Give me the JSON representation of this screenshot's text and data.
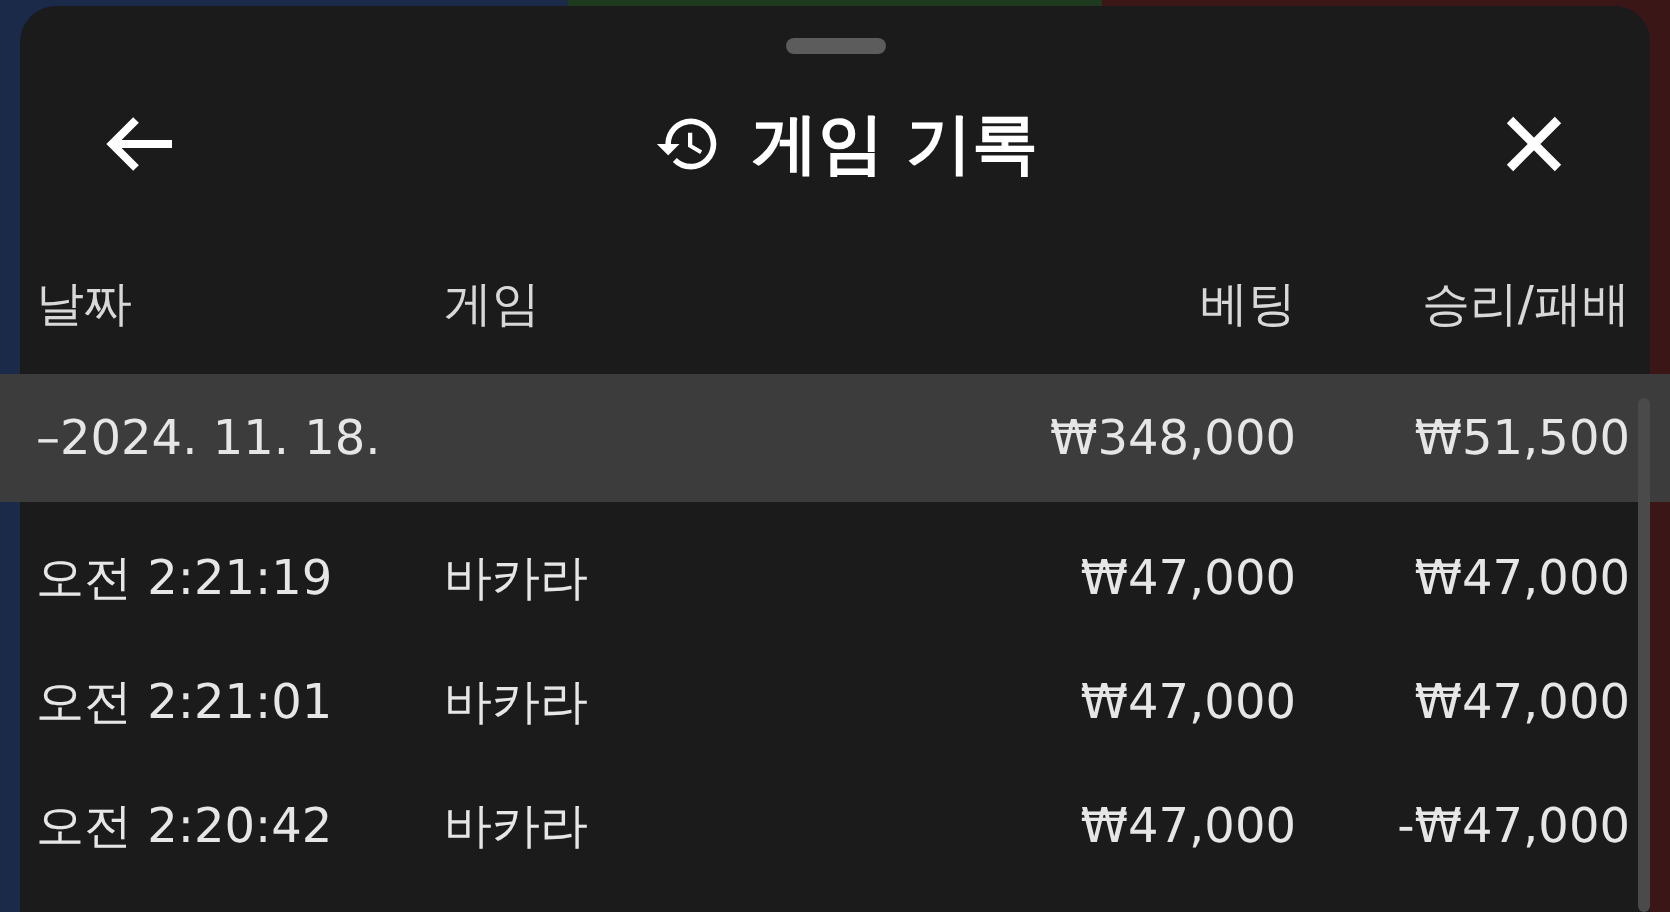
{
  "header": {
    "title": "게임 기록"
  },
  "table": {
    "columns": [
      "날짜",
      "게임",
      "베팅",
      "승리/패배"
    ],
    "group": {
      "date": "–2024. 11. 18.",
      "bet": "₩348,000",
      "win": "₩51,500"
    },
    "rows": [
      {
        "time": "오전 2:21:19",
        "game": "바카라",
        "bet": "₩47,000",
        "win": "₩47,000"
      },
      {
        "time": "오전 2:21:01",
        "game": "바카라",
        "bet": "₩47,000",
        "win": "₩47,000"
      },
      {
        "time": "오전 2:20:42",
        "game": "바카라",
        "bet": "₩47,000",
        "win": "-₩47,000"
      }
    ]
  }
}
